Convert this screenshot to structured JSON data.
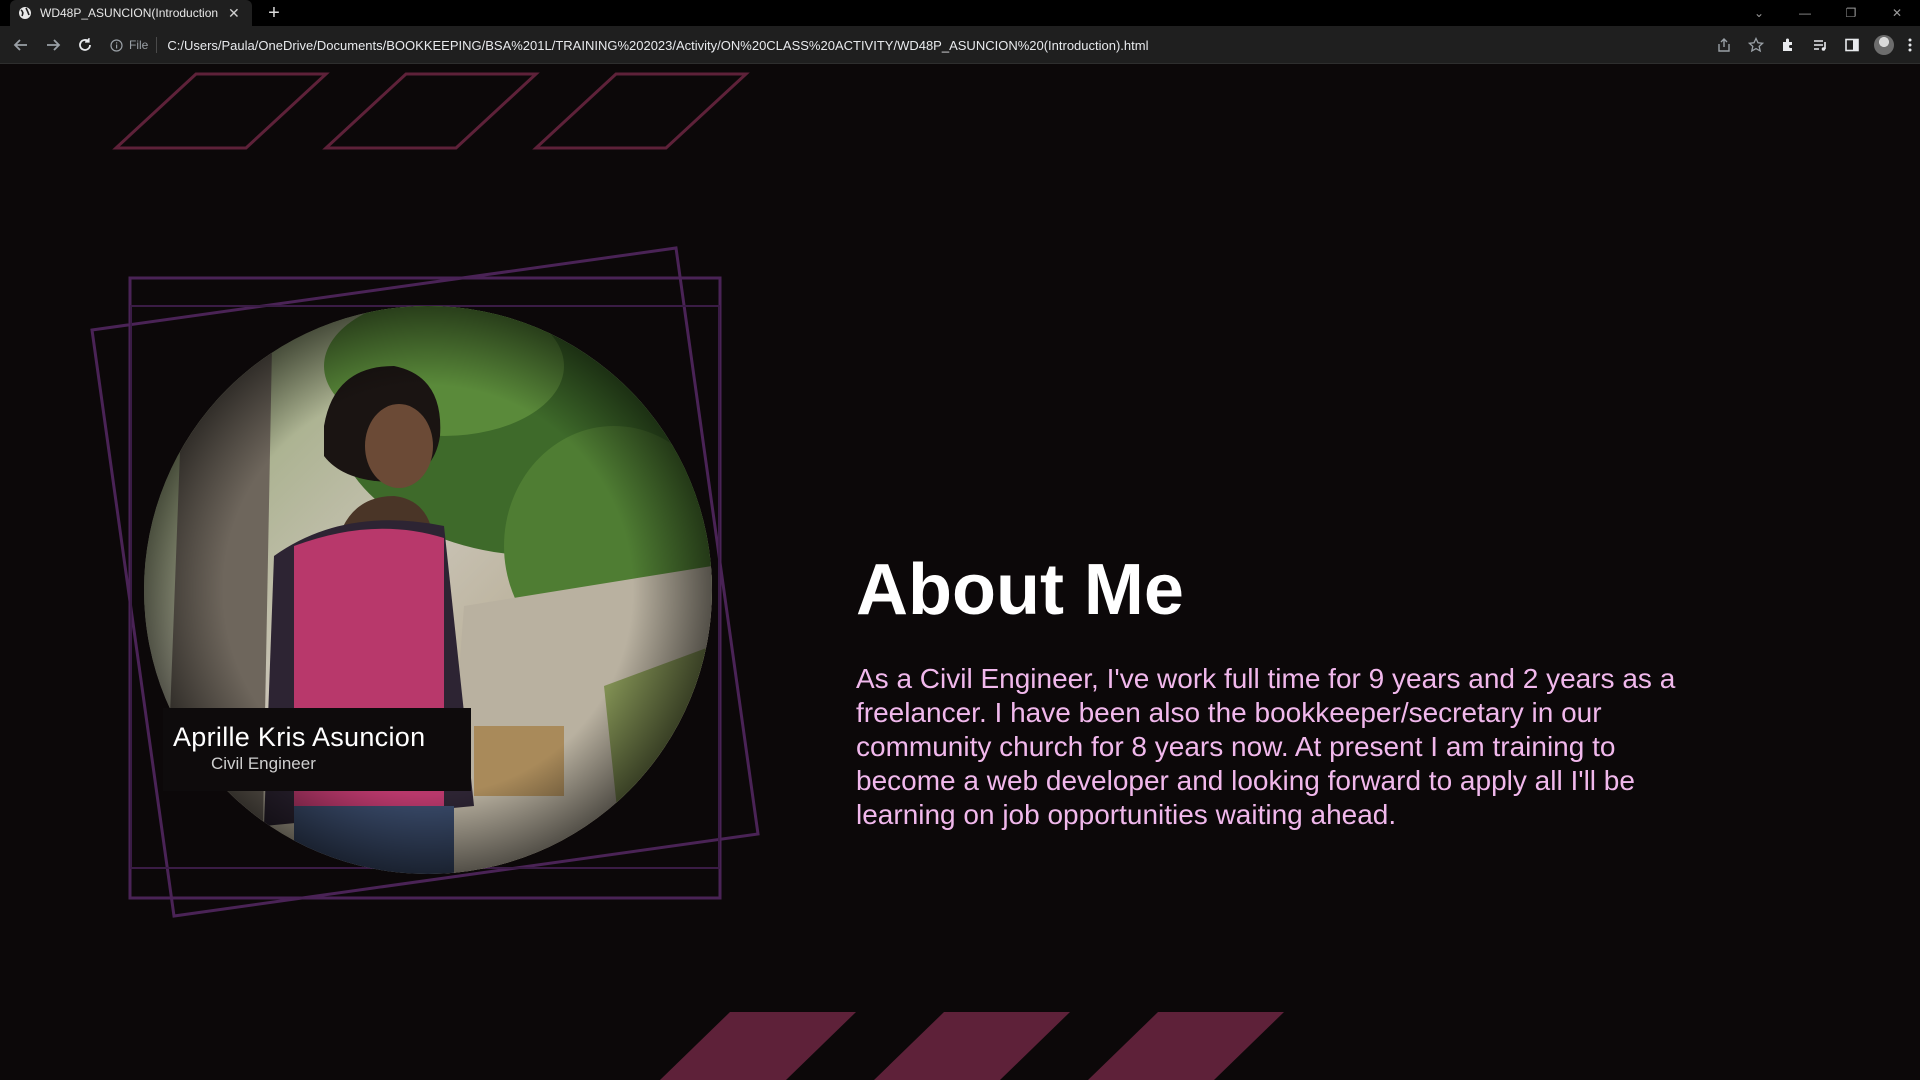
{
  "browser": {
    "tab_title": "WD48P_ASUNCION(Introduction",
    "tab_close": "✕",
    "new_tab": "+",
    "url_scheme_label": "File",
    "url": "C:/Users/Paula/OneDrive/Documents/BOOKKEEPING/BSA%201L/TRAINING%202023/Activity/ON%20CLASS%20ACTIVITY/WD48P_ASUNCION%20(Introduction).html"
  },
  "profile": {
    "name": "Aprille Kris Asuncion",
    "title": "Civil Engineer"
  },
  "about": {
    "heading": "About Me",
    "text": "As a Civil Engineer, I've work full time for 9 years and 2 years as a freelancer. I have been also the bookkeeper/secretary in our community church for 8 years now. At present I am training to become a web developer and looking forward to apply all I'll be learning on job opportunities waiting ahead."
  },
  "colors": {
    "page_bg": "#0c0809",
    "accent": "#5e2139",
    "frame": "#4a2356",
    "about_text": "#f1b8ec"
  }
}
